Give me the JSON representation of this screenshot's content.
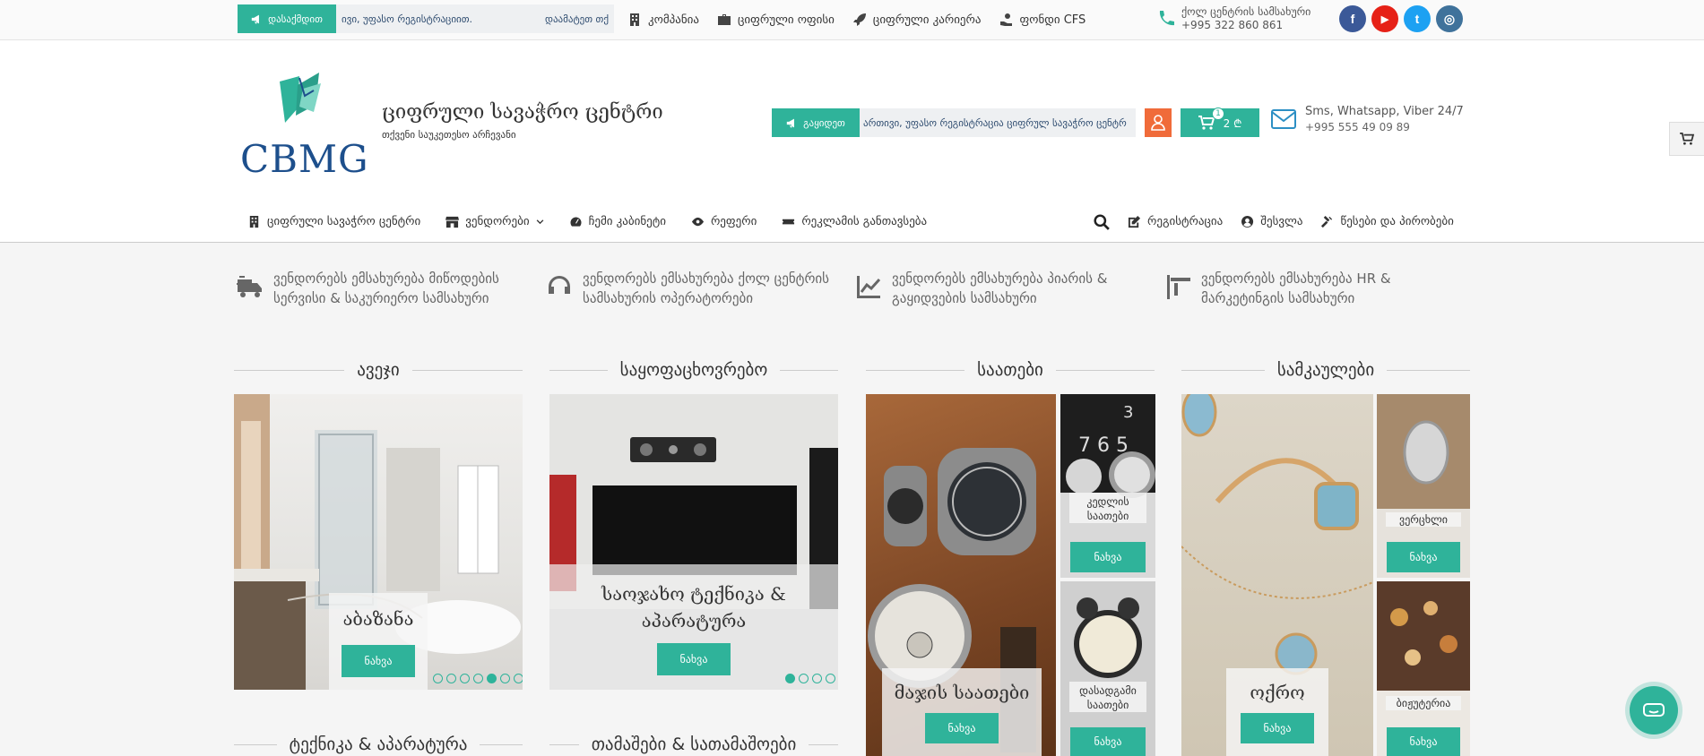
{
  "topbar": {
    "start_label": "დასაქმდით",
    "marquee_left": "ივი, უფასო რეგისტრაციით.",
    "marquee_right": "დაამატეთ თქ",
    "links": [
      {
        "label": "კომპანია",
        "icon": "building-icon"
      },
      {
        "label": "ციფრული ოფისი",
        "icon": "briefcase-icon"
      },
      {
        "label": "ციფრული კარიერა",
        "icon": "rocket-icon"
      },
      {
        "label": "ფონდი CFS",
        "icon": "hand-coin-icon"
      }
    ],
    "callcenter_label": "ქოლ ცენტრის სამსახური",
    "callcenter_phone": "+995 322 860 861",
    "social": [
      {
        "name": "facebook-icon",
        "glyph": "f",
        "color": "#3b5998"
      },
      {
        "name": "youtube-icon",
        "glyph": "▶",
        "color": "#e62117"
      },
      {
        "name": "twitter-icon",
        "glyph": "t",
        "color": "#1da1f2"
      },
      {
        "name": "instagram-icon",
        "glyph": "◎",
        "color": "#3f729b"
      }
    ]
  },
  "header": {
    "logo_text": "CBMG",
    "site_title": "ციფრული სავაჭრო ცენტრი",
    "site_subtitle": "თქვენი საუკეთესო არჩევანი",
    "sell_label": "გაყიდეთ",
    "marquee": "ართივი, უფასო რეგისტრაცია ციფრულ სავაჭრო ცენტრ",
    "cart_count": "1",
    "cart_total": "2 ₾",
    "contact_title": "Sms, Whatsapp, Viber 24/7",
    "contact_phone": "+995 555 49 09 89"
  },
  "nav": {
    "left": [
      {
        "label": "ციფრული სავაჭრო ცენტრი",
        "icon": "building-icon"
      },
      {
        "label": "ვენდორები",
        "icon": "store-icon",
        "dropdown": true
      },
      {
        "label": "ჩემი კაბინეტი",
        "icon": "dashboard-icon"
      },
      {
        "label": "რეფერი",
        "icon": "eye-icon"
      },
      {
        "label": "რეკლამის განთავსება",
        "icon": "ticket-icon"
      }
    ],
    "right": [
      {
        "label": "რეგისტრაცია",
        "icon": "edit-icon"
      },
      {
        "label": "შესვლა",
        "icon": "user-circle-icon"
      },
      {
        "label": "წესები და პირობები",
        "icon": "gavel-icon"
      }
    ]
  },
  "features": [
    {
      "line1": "ვენდორებს ემსახურება მიწოდების",
      "line2": "სერვისი & საკურიერო სამსახური",
      "icon": "truck-icon"
    },
    {
      "line1": "ვენდორებს ემსახურება ქოლ ცენტრის",
      "line2": "სამსახურის ოპერატორები",
      "icon": "headphones-icon"
    },
    {
      "line1": "ვენდორებს ემსახურება პიარის &",
      "line2": "გაყიდვების სამსახური",
      "icon": "chart-line-icon"
    },
    {
      "line1": "ვენდორებს ემსახურება HR &",
      "line2": "მარკეტინგის სამსახური",
      "icon": "flag-icon"
    }
  ],
  "categories": [
    {
      "title": "ავეჯი",
      "caption": "აბაზანა",
      "button": "ნახვა"
    },
    {
      "title": "საყოფაცხოვრებო",
      "caption": "საოჯახო ტექნიკა & აპარატურა",
      "button": "ნახვა"
    },
    {
      "title": "საათები",
      "caption": "მაჯის საათები",
      "button": "ნახვა",
      "mini": [
        {
          "caption": "კედლის საათები",
          "button": "ნახვა"
        },
        {
          "caption": "დასადგამი საათები",
          "button": "ნახვა"
        }
      ]
    },
    {
      "title": "სამკაულები",
      "caption": "ოქრო",
      "button": "ნახვა",
      "mini": [
        {
          "caption": "ვერცხლი",
          "button": "ნახვა"
        },
        {
          "caption": "ბიჟუტერია",
          "button": "ნახვა"
        }
      ]
    }
  ],
  "bottom_titles": [
    "ტექნიკა & აპარატურა",
    "თამაშები & სათამაშოები"
  ],
  "colors": {
    "accent": "#2fb39a",
    "orange": "#f06b3a",
    "logo_blue": "#1d4f8c"
  }
}
